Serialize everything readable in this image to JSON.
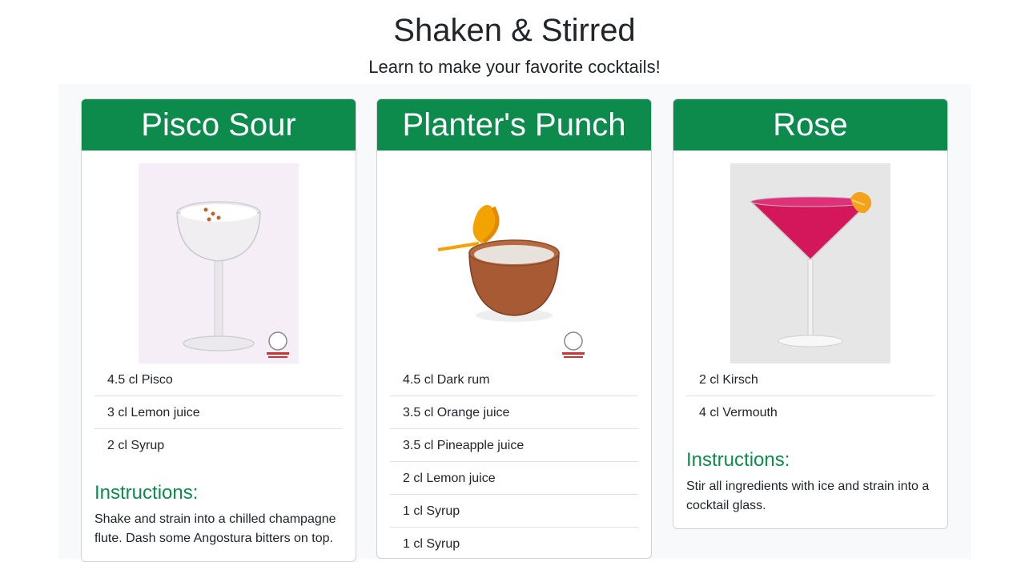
{
  "header": {
    "title": "Shaken & Stirred",
    "subtitle": "Learn to make your favorite cocktails!"
  },
  "colors": {
    "accent": "#0c8b4c",
    "page_band": "#f8f9fa"
  },
  "instructions_label": "Instructions:",
  "cocktails": [
    {
      "name": "Pisco Sour",
      "image": "pisco-sour-glass-image",
      "ingredients": [
        "4.5 cl Pisco",
        "3 cl Lemon juice",
        "2 cl Syrup"
      ],
      "instructions": "Shake and strain into a chilled champagne flute. Dash some Angostura bitters on top."
    },
    {
      "name": "Planter's Punch",
      "image": "planters-punch-cup-image",
      "ingredients": [
        "4.5 cl Dark rum",
        "3.5 cl Orange juice",
        "3.5 cl Pineapple juice",
        "2 cl Lemon juice",
        "1 cl Syrup",
        "1 cl Syrup"
      ],
      "instructions": ""
    },
    {
      "name": "Rose",
      "image": "rose-martini-glass-image",
      "ingredients": [
        "2 cl Kirsch",
        "4 cl Vermouth"
      ],
      "instructions": "Stir all ingredients with ice and strain into a cocktail glass."
    }
  ]
}
